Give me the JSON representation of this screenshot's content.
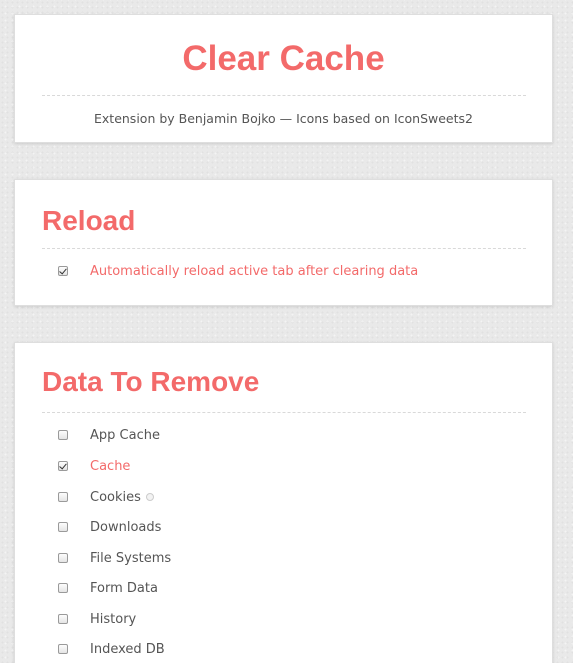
{
  "header": {
    "title": "Clear Cache",
    "subtitle": "Extension by Benjamin Bojko — Icons based on IconSweets2"
  },
  "reload": {
    "title": "Reload",
    "option": {
      "label": "Automatically reload active tab after clearing data",
      "checked": true
    }
  },
  "data_to_remove": {
    "title": "Data To Remove",
    "items": [
      {
        "label": "App Cache",
        "checked": false
      },
      {
        "label": "Cache",
        "checked": true
      },
      {
        "label": "Cookies",
        "checked": false,
        "icon": "info-icon"
      },
      {
        "label": "Downloads",
        "checked": false
      },
      {
        "label": "File Systems",
        "checked": false
      },
      {
        "label": "Form Data",
        "checked": false
      },
      {
        "label": "History",
        "checked": false
      },
      {
        "label": "Indexed DB",
        "checked": false
      }
    ]
  },
  "colors": {
    "accent": "#f36a6a",
    "text": "#555555",
    "background": "#e9e9e9",
    "card": "#ffffff"
  }
}
